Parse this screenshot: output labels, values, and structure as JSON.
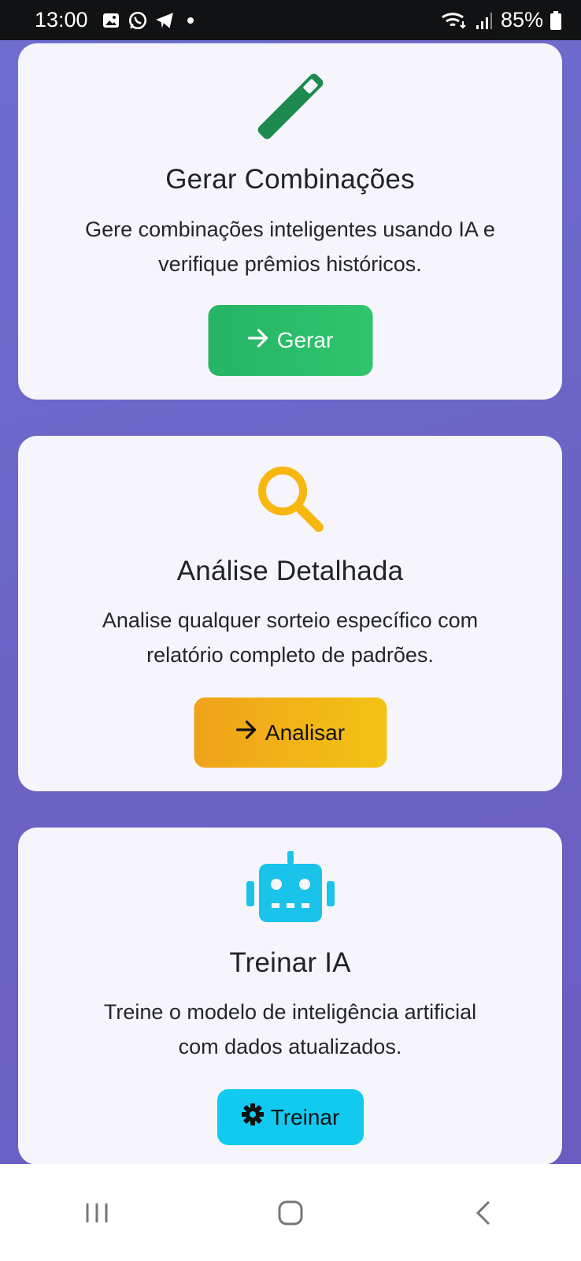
{
  "status_bar": {
    "time": "13:00",
    "battery": "85%",
    "icons": [
      "image-icon",
      "whatsapp-icon",
      "telegram-icon",
      "wifi-icon",
      "signal-icon",
      "battery-icon"
    ]
  },
  "cards": [
    {
      "icon": "wand-icon",
      "title": "Gerar Combinações",
      "description_line1": "Gere combinações inteligentes usando IA e",
      "description_line2": "verifique prêmios históricos.",
      "button_label": "Gerar",
      "button_icon": "arrow-right-icon",
      "button_color": "#27b967"
    },
    {
      "icon": "search-icon",
      "title": "Análise Detalhada",
      "description_line1": "Analise qualquer sorteio específico com",
      "description_line2": "relatório completo de padrões.",
      "button_label": "Analisar",
      "button_icon": "arrow-right-icon",
      "button_color": "#f0b018"
    },
    {
      "icon": "robot-icon",
      "title": "Treinar IA",
      "description_line1": "Treine o modelo de inteligência artificial",
      "description_line2": "com dados atualizados.",
      "button_label": "Treinar",
      "button_icon": "gear-icon",
      "button_color": "#12c9ef"
    }
  ],
  "nav_bar": {
    "buttons": [
      "recent-apps-icon",
      "home-icon",
      "back-icon"
    ]
  }
}
